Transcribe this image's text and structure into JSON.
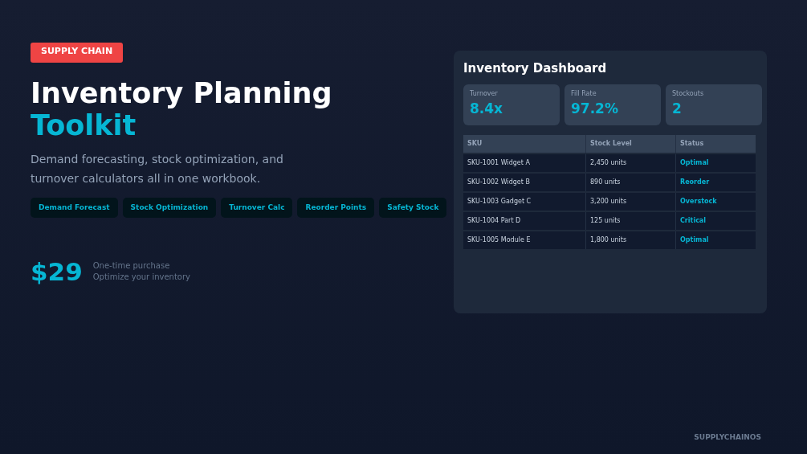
{
  "badge": "SUPPLY CHAIN",
  "title": {
    "line1": "Inventory Planning",
    "line2": "Toolkit"
  },
  "subtitle": "Demand forecasting, stock optimization, and turnover calculators all in one workbook.",
  "features": [
    "Demand Forecast",
    "Stock Optimization",
    "Turnover Calc",
    "Reorder Points",
    "Safety Stock"
  ],
  "price": {
    "amount": "$29",
    "note1": "One-time purchase",
    "note2": "Optimize your inventory"
  },
  "dashboard": {
    "title": "Inventory Dashboard",
    "metrics": [
      {
        "label": "Turnover",
        "value": "8.4x"
      },
      {
        "label": "Fill Rate",
        "value": "97.2%"
      },
      {
        "label": "Stockouts",
        "value": "2"
      }
    ],
    "table": {
      "columns": [
        "SKU",
        "Stock Level",
        "Status"
      ],
      "rows": [
        [
          "SKU-1001 Widget A",
          "2,450 units",
          "Optimal"
        ],
        [
          "SKU-1002 Widget B",
          "890 units",
          "Reorder"
        ],
        [
          "SKU-1003 Gadget C",
          "3,200 units",
          "Overstock"
        ],
        [
          "SKU-1004 Part D",
          "125 units",
          "Critical"
        ],
        [
          "SKU-1005 Module E",
          "1,800 units",
          "Optimal"
        ]
      ]
    }
  },
  "footer": "SUPPLYCHAINOS"
}
